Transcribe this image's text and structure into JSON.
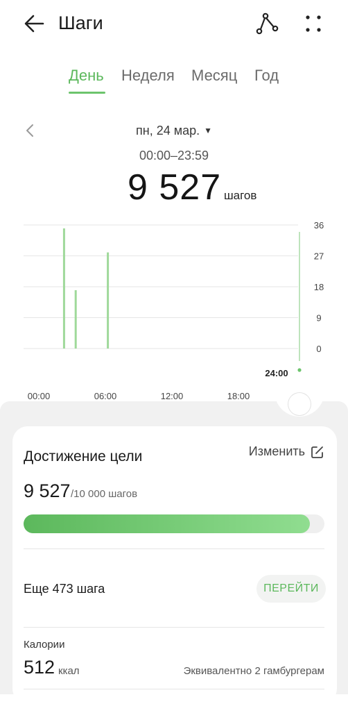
{
  "header": {
    "title": "Шаги",
    "back_icon": "arrow-left-icon",
    "route_icon": "route-icon",
    "more_icon": "more-dots-icon"
  },
  "tabs": [
    {
      "label": "День",
      "active": true
    },
    {
      "label": "Неделя",
      "active": false
    },
    {
      "label": "Месяц",
      "active": false
    },
    {
      "label": "Год",
      "active": false
    }
  ],
  "date": {
    "label": "пн, 24 мар.",
    "range": "00:00–23:59"
  },
  "summary": {
    "steps": "9 527",
    "unit": "шагов"
  },
  "chart_data": {
    "type": "bar",
    "x_ticks": [
      "00:00",
      "06:00",
      "12:00",
      "18:00"
    ],
    "end_label": "24:00",
    "y_ticks": [
      "36",
      "27",
      "18",
      "9",
      "0"
    ],
    "ylim": [
      0,
      36
    ],
    "xlim_hours": [
      0,
      24
    ],
    "bars": [
      {
        "hour": 3.65,
        "value": 35
      },
      {
        "hour": 4.7,
        "value": 17
      },
      {
        "hour": 7.6,
        "value": 28
      }
    ],
    "bar_color": "#9fd99a",
    "grid": true
  },
  "goal": {
    "title": "Достижение цели",
    "edit_label": "Изменить",
    "value": "9 527",
    "target": "/10 000 шагов",
    "progress": 0.9527,
    "remaining": "Еще 473 шага",
    "go_label": "ПЕРЕЙТИ"
  },
  "calories": {
    "label": "Калории",
    "value": "512",
    "unit": "ккал",
    "equivalent": "Эквивалентно 2 гамбургерам"
  },
  "colors": {
    "accent": "#5cb85c",
    "bar": "#9fd99a",
    "sheet": "#f1f1f1"
  }
}
